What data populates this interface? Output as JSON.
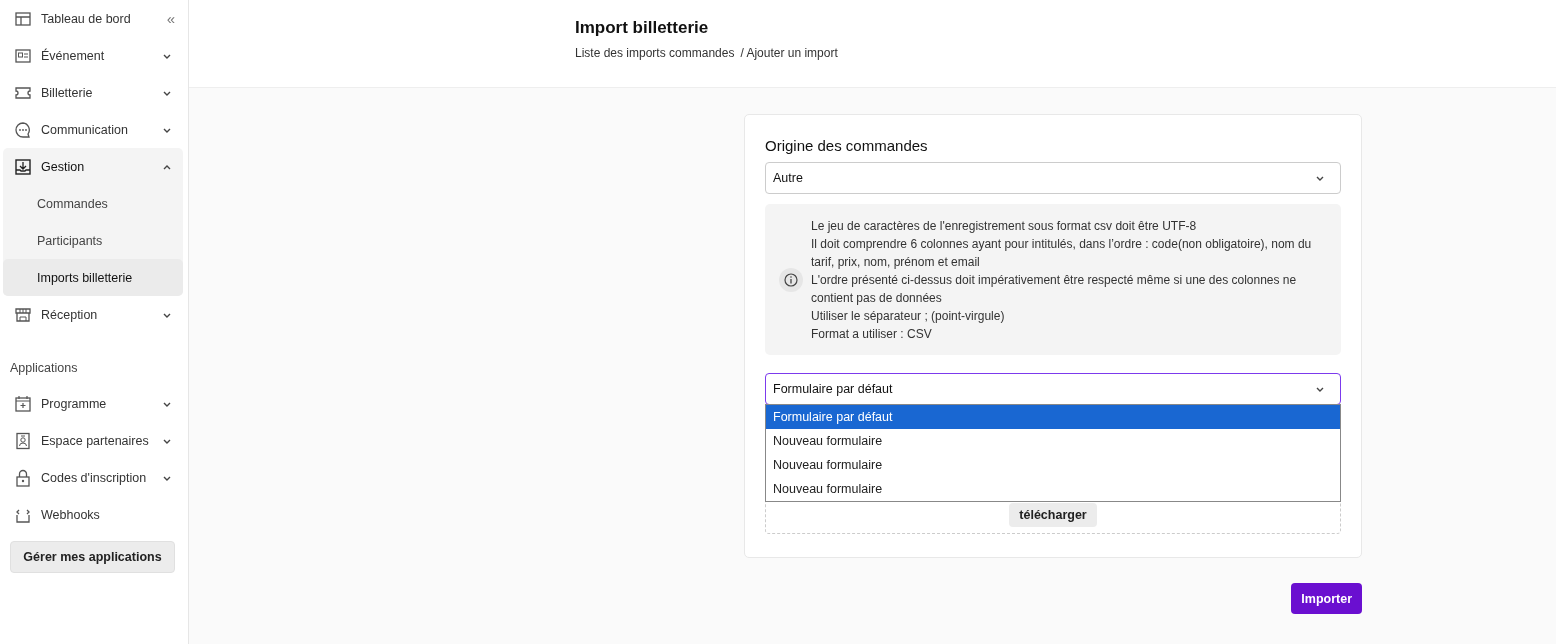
{
  "sidebar": {
    "items": [
      {
        "kind": "link",
        "label": "Tableau de bord",
        "collapse": "«"
      },
      {
        "kind": "group",
        "label": "Événement",
        "expanded": false
      },
      {
        "kind": "group",
        "label": "Billetterie",
        "expanded": false
      },
      {
        "kind": "group",
        "label": "Communication",
        "expanded": false
      },
      {
        "kind": "group",
        "label": "Gestion",
        "expanded": true,
        "children": [
          {
            "label": "Commandes",
            "selected": false
          },
          {
            "label": "Participants",
            "selected": false
          },
          {
            "label": "Imports billetterie",
            "selected": true
          }
        ]
      },
      {
        "kind": "group",
        "label": "Réception",
        "expanded": false
      }
    ],
    "section_title": "Applications",
    "apps": [
      {
        "kind": "group",
        "label": "Programme",
        "expanded": false
      },
      {
        "kind": "group",
        "label": "Espace partenaires",
        "expanded": false
      },
      {
        "kind": "group",
        "label": "Codes d'inscription",
        "expanded": false
      },
      {
        "kind": "link",
        "label": "Webhooks"
      }
    ],
    "manage_button": "Gérer mes applications"
  },
  "header": {
    "title": "Import billetterie",
    "breadcrumb": [
      "Liste des imports commandes",
      "/ Ajouter un import"
    ]
  },
  "card": {
    "origin_label": "Origine des commandes",
    "origin_value": "Autre",
    "info_lines": [
      "Le jeu de caractères de l'enregistrement sous format csv doit être UTF-8",
      "Il doit comprendre 6 colonnes ayant pour intitulés, dans l’ordre : code(non obligatoire), nom du tarif, prix, nom, prénom et email",
      "L'ordre présenté ci-dessus doit impérativement être respecté même si une des colonnes ne contient pas de données",
      "Utiliser le séparateur ; (point-virgule)",
      "Format a utiliser : CSV"
    ],
    "form_select": {
      "value": "Formulaire par défaut",
      "open": true,
      "options": [
        {
          "label": "Formulaire par défaut",
          "selected": true
        },
        {
          "label": "Nouveau formulaire",
          "selected": false
        },
        {
          "label": "Nouveau formulaire",
          "selected": false
        },
        {
          "label": "Nouveau formulaire",
          "selected": false
        }
      ]
    },
    "upload_button": "télécharger"
  },
  "import_button": "Importer"
}
